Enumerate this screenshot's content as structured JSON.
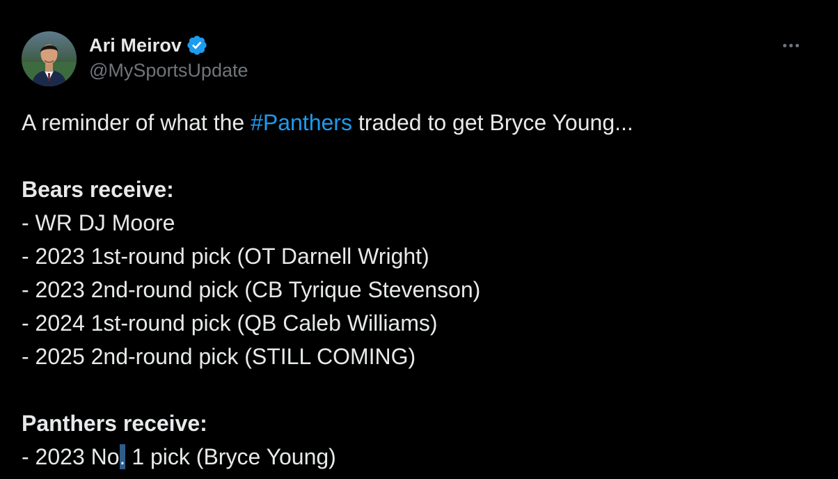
{
  "author": {
    "display_name": "Ari Meirov",
    "handle": "@MySportsUpdate",
    "verified_icon": "verified-badge-icon",
    "avatar_icon": "avatar-photo"
  },
  "more_icon": "more-horizontal-icon",
  "tweet": {
    "intro_before": "A reminder of what the ",
    "hashtag": "#Panthers",
    "intro_after": " traded to get Bryce Young...",
    "bears_heading": "Bears receive:",
    "bears_items": [
      "- WR DJ Moore",
      "- 2023 1st-round pick (OT Darnell Wright)",
      "- 2023 2nd-round pick (CB Tyrique Stevenson)",
      "- 2024 1st-round pick (QB Caleb Williams)",
      "- 2025 2nd-round pick (STILL COMING)"
    ],
    "panthers_heading": "Panthers receive:",
    "panthers_item_before": "- 2023 No",
    "panthers_item_selected": ".",
    "panthers_item_after": " 1 pick (Bryce Young)"
  },
  "colors": {
    "background": "#000000",
    "text": "#e7e9ea",
    "secondary": "#71767b",
    "accent": "#1d9bf0",
    "selection": "#2f5d8a"
  }
}
